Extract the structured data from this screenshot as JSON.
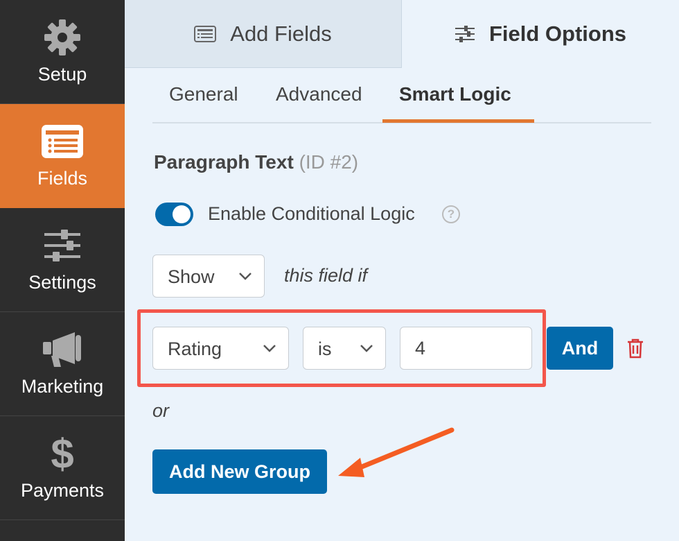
{
  "sidebar": {
    "items": [
      {
        "label": "Setup",
        "icon": "gear-icon",
        "active": false
      },
      {
        "label": "Fields",
        "icon": "list-icon",
        "active": true
      },
      {
        "label": "Settings",
        "icon": "sliders-icon",
        "active": false
      },
      {
        "label": "Marketing",
        "icon": "megaphone-icon",
        "active": false
      },
      {
        "label": "Payments",
        "icon": "dollar-icon",
        "active": false
      }
    ]
  },
  "top_tabs": {
    "add_fields": "Add Fields",
    "field_options": "Field Options"
  },
  "sub_tabs": [
    "General",
    "Advanced",
    "Smart Logic"
  ],
  "field": {
    "name": "Paragraph Text",
    "id_label": "(ID #2)"
  },
  "conditional": {
    "toggle_label": "Enable Conditional Logic",
    "enabled": true,
    "help": "?",
    "action_value": "Show",
    "action_suffix": "this field if",
    "rule": {
      "field": "Rating",
      "operator": "is",
      "value": "4"
    },
    "and_label": "And",
    "or_label": "or",
    "add_group_label": "Add New Group"
  },
  "colors": {
    "sidebar_bg": "#2d2d2d",
    "accent_orange": "#e27730",
    "primary_blue": "#036aab",
    "highlight_red": "#f3564b",
    "background": "#ebf3fb"
  }
}
